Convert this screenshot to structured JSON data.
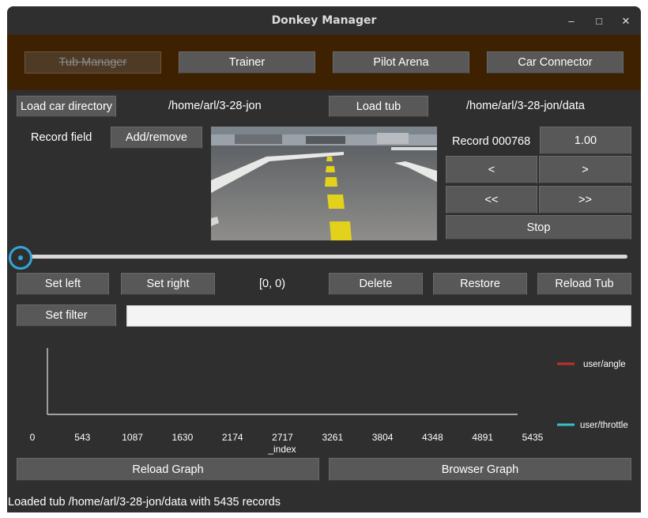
{
  "window": {
    "title": "Donkey Manager",
    "controls": {
      "minimize": "–",
      "maximize": "□",
      "close": "✕"
    }
  },
  "tabs": [
    {
      "label": "Tub Manager",
      "disabled": true
    },
    {
      "label": "Trainer"
    },
    {
      "label": "Pilot Arena"
    },
    {
      "label": "Car Connector"
    }
  ],
  "directory": {
    "load_car_label": "Load car directory",
    "car_path": "/home/arl/3-28-jon",
    "load_tub_label": "Load tub",
    "tub_path": "/home/arl/3-28-jon/data"
  },
  "record": {
    "field_label": "Record field",
    "add_remove_label": "Add/remove",
    "record_label": "Record 000768",
    "speed_value": "1.00",
    "prev_label": "<",
    "next_label": ">",
    "fast_back_label": "<<",
    "fast_forward_label": ">>",
    "stop_label": "Stop"
  },
  "slider": {
    "progress": 0.0
  },
  "selection": {
    "set_left_label": "Set left",
    "set_right_label": "Set right",
    "range_text": "[0, 0)",
    "delete_label": "Delete",
    "restore_label": "Restore",
    "reload_tub_label": "Reload Tub"
  },
  "filter": {
    "set_filter_label": "Set filter",
    "value": "",
    "placeholder": ""
  },
  "chart_data": {
    "type": "line",
    "xlabel": "_index",
    "x_ticks": [
      "0",
      "543",
      "1087",
      "1630",
      "2174",
      "2717",
      "3261",
      "3804",
      "4348",
      "4891",
      "5435"
    ],
    "xlim": [
      0,
      5435
    ],
    "series": [
      {
        "name": "user/angle",
        "color": "#c0302c",
        "values": []
      },
      {
        "name": "user/throttle",
        "color": "#33c3c6",
        "values": []
      }
    ],
    "legend_position": "right"
  },
  "graph_buttons": {
    "reload_label": "Reload Graph",
    "browser_label": "Browser Graph"
  },
  "status": {
    "text": "Loaded tub /home/arl/3-28-jon/data with 5435 records"
  },
  "colors": {
    "background": "#2f2f2f",
    "tab_bar": "#3d2100",
    "button": "#585858",
    "slider_accent": "#33a6d8"
  }
}
